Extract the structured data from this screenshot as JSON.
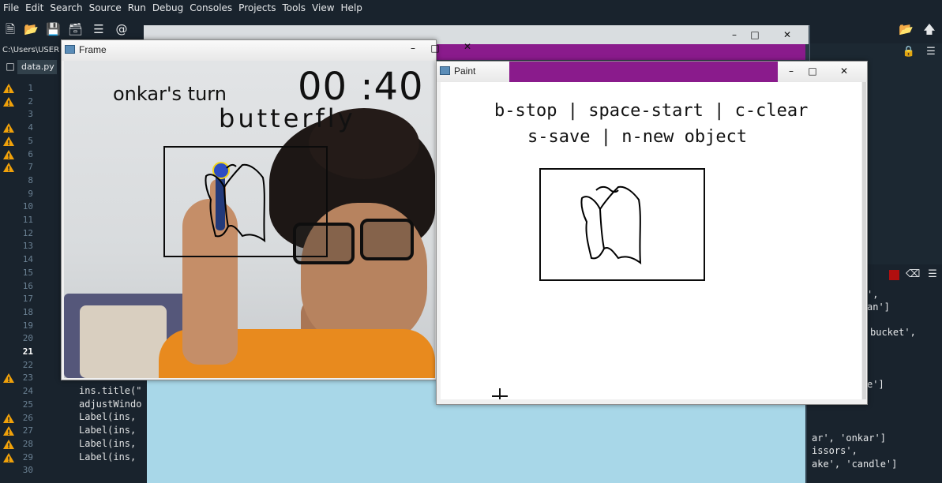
{
  "menubar": {
    "items": [
      "File",
      "Edit",
      "Search",
      "Source",
      "Run",
      "Debug",
      "Consoles",
      "Projects",
      "Tools",
      "View",
      "Help"
    ]
  },
  "toolbar": {
    "icons": [
      "new-file-icon",
      "open-folder-icon",
      "save-icon",
      "save-all-icon",
      "outline-icon",
      "at-icon"
    ]
  },
  "path_label": "C:\\Users\\USER",
  "editor_tab": {
    "label": "data.py"
  },
  "gutter": {
    "lines": [
      {
        "num": "1",
        "warn": true
      },
      {
        "num": "2",
        "warn": true
      },
      {
        "num": "3",
        "warn": false
      },
      {
        "num": "4",
        "warn": true
      },
      {
        "num": "5",
        "warn": true
      },
      {
        "num": "6",
        "warn": true
      },
      {
        "num": "7",
        "warn": true
      },
      {
        "num": "8",
        "warn": false
      },
      {
        "num": "9",
        "warn": false
      },
      {
        "num": "10",
        "warn": false
      },
      {
        "num": "11",
        "warn": false
      },
      {
        "num": "12",
        "warn": false
      },
      {
        "num": "13",
        "warn": false
      },
      {
        "num": "14",
        "warn": false
      },
      {
        "num": "15",
        "warn": false
      },
      {
        "num": "16",
        "warn": false
      },
      {
        "num": "17",
        "warn": false
      },
      {
        "num": "18",
        "warn": false
      },
      {
        "num": "19",
        "warn": false
      },
      {
        "num": "20",
        "warn": false
      },
      {
        "num": "21",
        "warn": false,
        "current": true
      },
      {
        "num": "22",
        "warn": false
      },
      {
        "num": "23",
        "warn": true
      },
      {
        "num": "24",
        "warn": false
      },
      {
        "num": "25",
        "warn": false
      },
      {
        "num": "26",
        "warn": true
      },
      {
        "num": "27",
        "warn": true
      },
      {
        "num": "28",
        "warn": true
      },
      {
        "num": "29",
        "warn": true
      },
      {
        "num": "30",
        "warn": false
      }
    ]
  },
  "code_lines": [
    {
      "line": "24",
      "text": "ins.title(\""
    },
    {
      "line": "25",
      "text": "adjustWindo"
    },
    {
      "line": "26",
      "text": "Label(ins,"
    },
    {
      "line": "27",
      "text": "Label(ins,"
    },
    {
      "line": "28",
      "text": "Label(ins,"
    },
    {
      "line": "29",
      "text": "Label(ins,"
    }
  ],
  "console_lines": [
    {
      "text": "',"
    },
    {
      "text": "an']"
    },
    {
      "text": "bucket',"
    },
    {
      "text": "e']"
    },
    {
      "text": "ar', 'onkar']"
    },
    {
      "text": "issors',"
    },
    {
      "text": "ake', 'candle']"
    }
  ],
  "frame_window": {
    "title": "Frame",
    "min_label": "–",
    "max_label": "□",
    "close_label": "✕",
    "overlay": {
      "turn_text": "onkar's turn",
      "timer": "00 :40",
      "word": "butterfly"
    }
  },
  "paint_window": {
    "title": "Paint",
    "min_label": "–",
    "max_label": "□",
    "close_label": "✕",
    "help_line1": "b-stop | space-start | c-clear",
    "help_line2": "s-save | n-new object"
  },
  "background_window": {
    "min_label": "–",
    "max_label": "□",
    "close_label": "✕"
  },
  "colors": {
    "ide_bg": "#19232d",
    "warning": "#f0a10a",
    "close_red": "#c84032",
    "sky_panel": "#a8d7e8",
    "purple_bar": "#8a1b8c"
  }
}
